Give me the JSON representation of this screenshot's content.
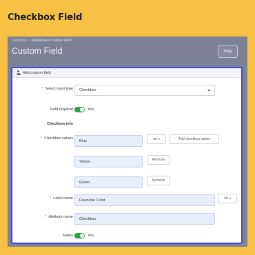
{
  "banner": {
    "title": "Checkbox Field"
  },
  "breadcrumb": {
    "items": [
      "Customer",
      "Registration Custom Field"
    ],
    "separator": "/"
  },
  "page": {
    "title": "Custom Field",
    "help_label": "Help"
  },
  "card": {
    "header": "Add custom field"
  },
  "form": {
    "input_type": {
      "label": "Select input type",
      "value": "Checkbox"
    },
    "required": {
      "label": "Field required",
      "toggle_on": true,
      "toggle_text": "Yes"
    },
    "section_title": "Checkbox info",
    "checkbox_values": {
      "label": "Checkbox values",
      "items": [
        "Blue",
        "Yellow",
        "Green"
      ],
      "lang_value": "en",
      "add_option_label": "Add checkbox option",
      "remove_label": "Remove"
    },
    "label_name": {
      "label": "Label name",
      "value": "Favourite Color",
      "lang_value": "en"
    },
    "attribute_name": {
      "label": "Attribute name",
      "value": "Checkbox"
    },
    "status": {
      "label": "Status",
      "toggle_on": true,
      "toggle_text": "Yes"
    }
  },
  "colors": {
    "background": "#f7c244",
    "accent_border": "#3f47d6",
    "toggle_on": "#2f9e44",
    "required_star": "#e03131",
    "input_fill": "#e9eefc"
  }
}
